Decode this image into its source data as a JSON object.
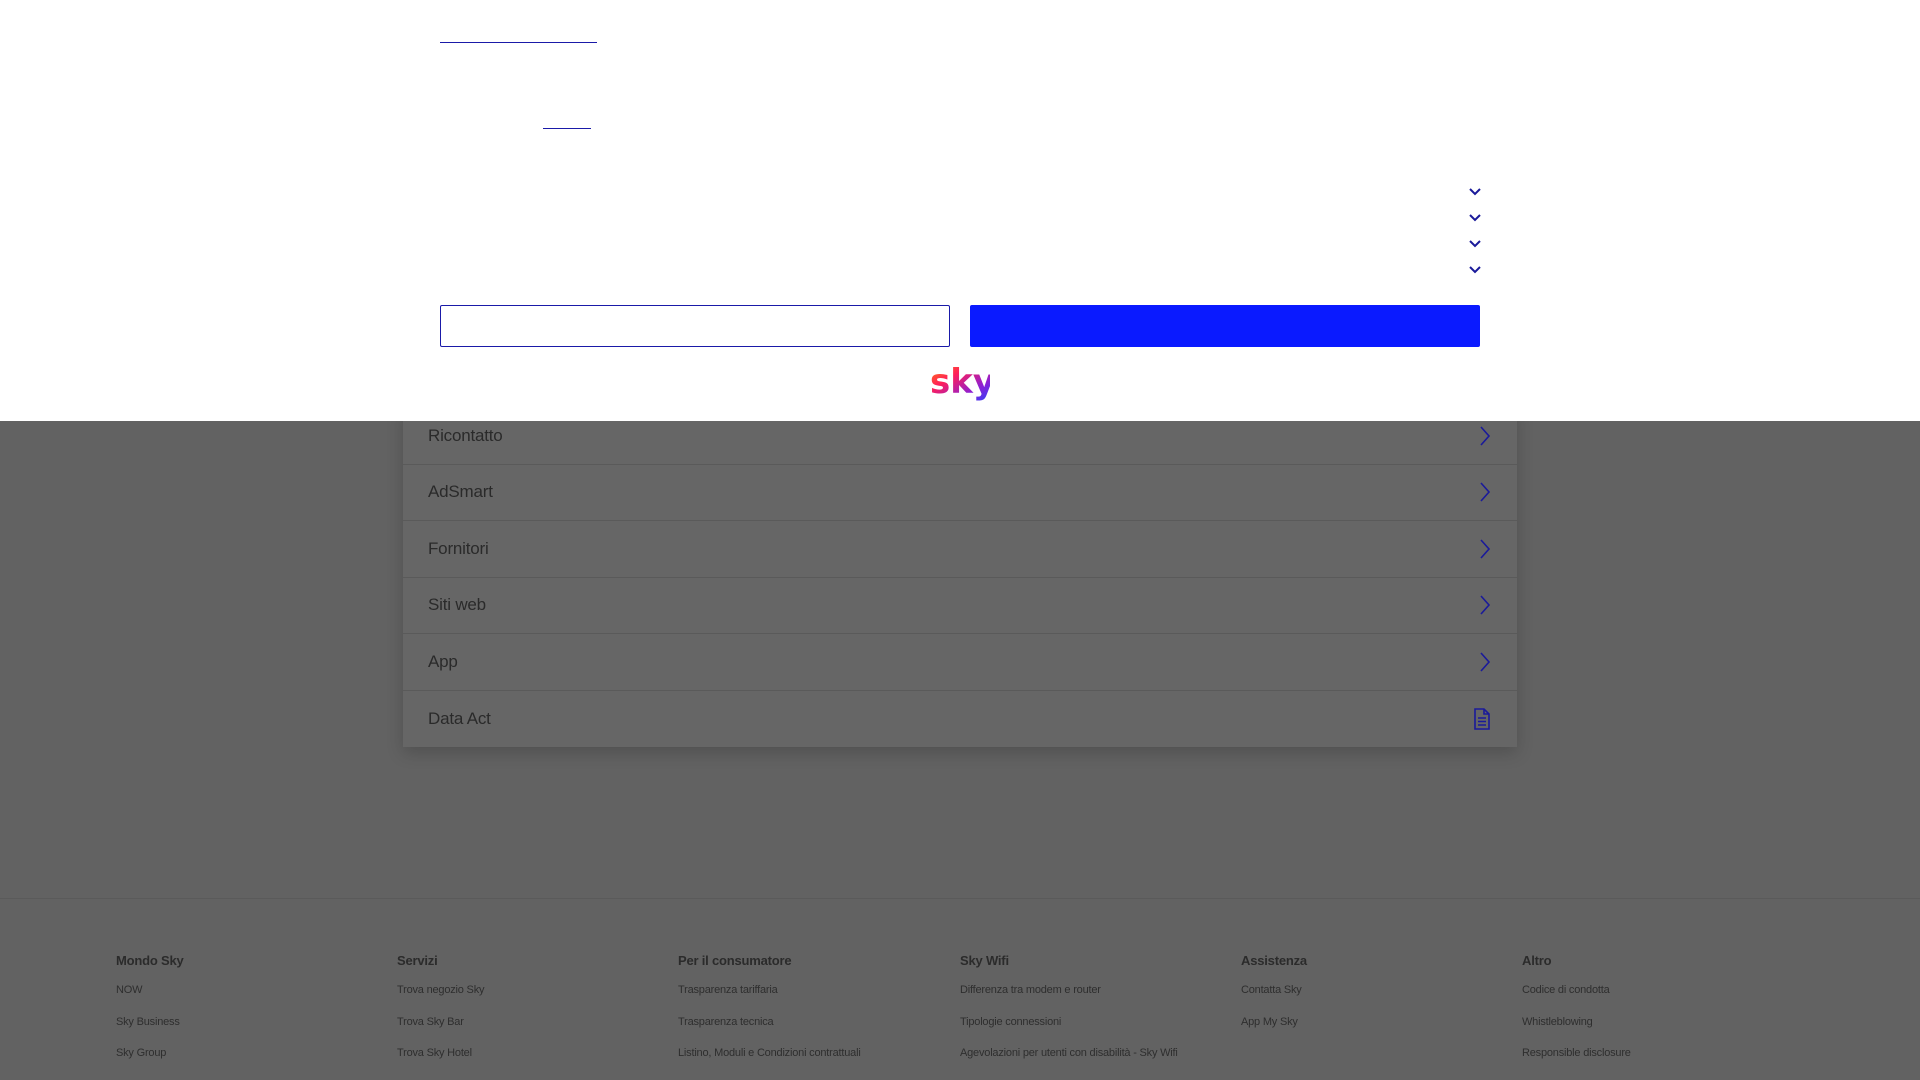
{
  "list": {
    "items": [
      {
        "label": "Ricontatto",
        "icon": "chevron-right-icon"
      },
      {
        "label": "AdSmart",
        "icon": "chevron-right-icon"
      },
      {
        "label": "Fornitori",
        "icon": "chevron-right-icon"
      },
      {
        "label": "Siti web",
        "icon": "chevron-right-icon"
      },
      {
        "label": "App",
        "icon": "chevron-right-icon"
      },
      {
        "label": "Data Act",
        "icon": "document-icon"
      }
    ]
  },
  "footer": {
    "columns": [
      {
        "title": "Mondo Sky",
        "links": [
          "NOW",
          "Sky Business",
          "Sky Group"
        ]
      },
      {
        "title": "Servizi",
        "links": [
          "Trova negozio Sky",
          "Trova Sky Bar",
          "Trova Sky Hotel"
        ]
      },
      {
        "title": "Per il consumatore",
        "links": [
          "Trasparenza tariffaria",
          "Trasparenza tecnica",
          "Listino, Moduli e Condizioni contrattuali"
        ]
      },
      {
        "title": "Sky Wifi",
        "links": [
          "Differenza tra modem e router",
          "Tipologie connessioni",
          "Agevolazioni per utenti con disabilità - Sky Wifi"
        ]
      },
      {
        "title": "Assistenza",
        "links": [
          "Contatta Sky",
          "App My Sky"
        ]
      },
      {
        "title": "Altro",
        "links": [
          "Codice di condotta",
          "Whistleblowing",
          "Responsible disclosure"
        ]
      }
    ]
  },
  "consent": {
    "expanders": [
      "chevron-down-icon",
      "chevron-down-icon",
      "chevron-down-icon",
      "chevron-down-icon"
    ],
    "brand": "sky",
    "colors": {
      "primary_button": "#0a1aff",
      "accent": "#1a1aa8",
      "overlay": "#626262"
    }
  }
}
